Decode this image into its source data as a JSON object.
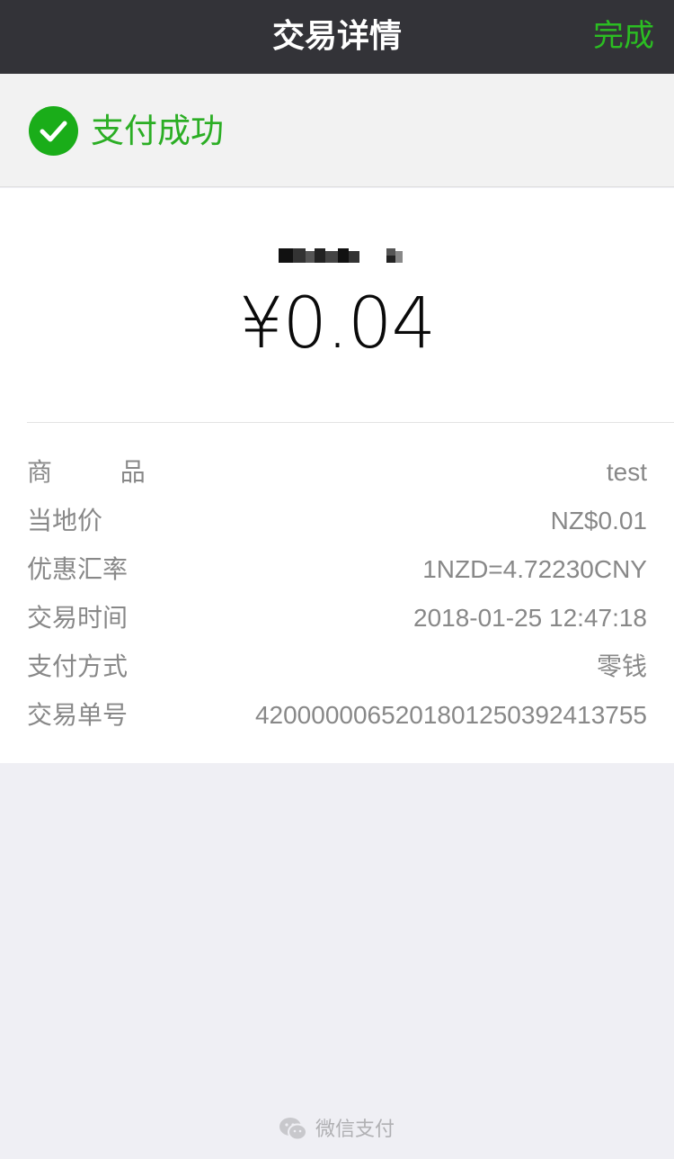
{
  "navbar": {
    "title": "交易详情",
    "done_label": "完成"
  },
  "status": {
    "text": "支付成功",
    "accent": "#2bae24",
    "icon": "check-circle-icon"
  },
  "payment": {
    "amount": "¥0.04"
  },
  "details": [
    {
      "label": "商 品",
      "value": "test"
    },
    {
      "label": "当地价",
      "value": "NZ$0.01"
    },
    {
      "label": "优惠汇率",
      "value": "1NZD=4.72230CNY"
    },
    {
      "label": "交易时间",
      "value": "2018-01-25 12:47:18"
    },
    {
      "label": "支付方式",
      "value": "零钱"
    },
    {
      "label": "交易单号",
      "value": "4200000065201801250392413755"
    }
  ],
  "footer": {
    "text": "微信支付",
    "icon": "wechat-logo-icon"
  }
}
